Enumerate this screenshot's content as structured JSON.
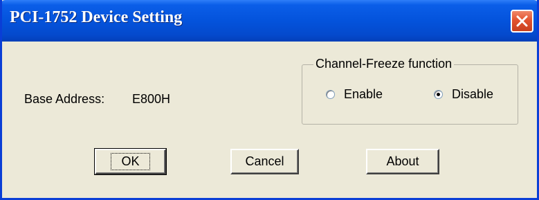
{
  "window": {
    "title": "PCI-1752 Device Setting",
    "close_icon": "close-icon"
  },
  "base_address": {
    "label": "Base Address:",
    "value": "E800H"
  },
  "channel_freeze": {
    "title": "Channel-Freeze function",
    "options": [
      {
        "label": "Enable",
        "checked": false
      },
      {
        "label": "Disable",
        "checked": true
      }
    ]
  },
  "buttons": {
    "ok": "OK",
    "cancel": "Cancel",
    "about": "About"
  },
  "colors": {
    "titlebar": "#0453dc",
    "dialog_bg": "#ece9d8",
    "close_button": "#e2532f"
  }
}
